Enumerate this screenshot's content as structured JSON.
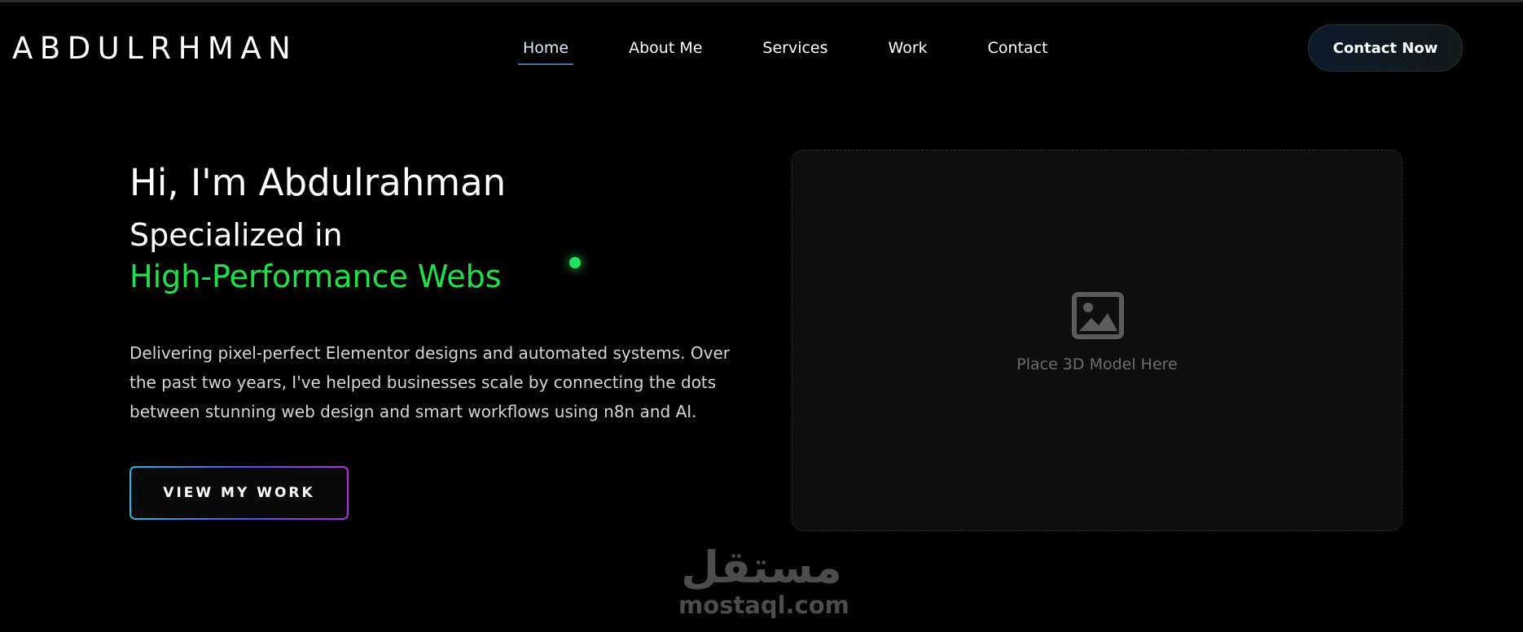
{
  "header": {
    "logo": "ABDULRHMAN",
    "nav": [
      {
        "label": "Home",
        "active": true
      },
      {
        "label": "About Me",
        "active": false
      },
      {
        "label": "Services",
        "active": false
      },
      {
        "label": "Work",
        "active": false
      },
      {
        "label": "Contact",
        "active": false
      }
    ],
    "cta_label": "Contact Now"
  },
  "hero": {
    "title": "Hi, I'm Abdulrahman",
    "subtitle_line1": "Specialized in",
    "subtitle_line2": "High-Performance Webs",
    "description": "Delivering pixel-perfect Elementor designs and automated systems. Over the past two years, I've helped businesses scale by connecting the dots between stunning web design and smart workflows using n8n and AI.",
    "button_label": "VIEW MY WORK"
  },
  "media": {
    "icon": "image-icon",
    "label": "Place 3D Model Here"
  },
  "watermark": {
    "text": "mostaql.com",
    "arabic": "مستقل"
  },
  "colors": {
    "background": "#000000",
    "accent_green": "#22e04a",
    "nav_underline": "#4a6fa0",
    "button_gradient_start": "#21b7e6",
    "button_gradient_end": "#b12ee4"
  }
}
